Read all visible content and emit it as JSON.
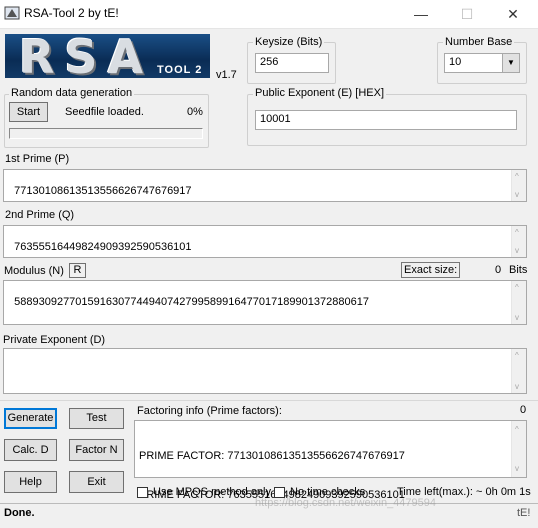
{
  "window": {
    "title": "RSA-Tool 2 by tE!",
    "minimize": "—",
    "maximize": "☐",
    "close": "✕"
  },
  "logo": {
    "text": "RSA",
    "subtitle": "TOOL 2",
    "version": "v1.7"
  },
  "keysize": {
    "label": "Keysize (Bits)",
    "value": "256"
  },
  "number_base": {
    "label": "Number Base",
    "value": "10"
  },
  "random": {
    "label": "Random data generation",
    "start_label": "Start",
    "status": "Seedfile loaded.",
    "percent": "0%",
    "progress": 0
  },
  "public_exponent": {
    "label": "Public Exponent (E) [HEX]",
    "value": "10001"
  },
  "prime1": {
    "label": "1st Prime (P)",
    "value": "77130108613513556626747676917"
  },
  "prime2": {
    "label": "2nd Prime (Q)",
    "value": "76355516449824909392590536101"
  },
  "modulus": {
    "label": "Modulus (N)",
    "r_label": "R",
    "exact_size_label": "Exact size:",
    "exact_size_value": "0",
    "bits_label": "Bits",
    "value": "5889309277015916307744940742799589916477017189901372880617"
  },
  "private_exponent": {
    "label": "Private Exponent (D)",
    "value": ""
  },
  "buttons": {
    "generate": "Generate",
    "test": "Test",
    "calc_d": "Calc. D",
    "factor_n": "Factor N",
    "help": "Help",
    "exit": "Exit"
  },
  "factoring": {
    "label": "Factoring info (Prime factors):",
    "count": "0",
    "lines": [
      "PRIME FACTOR: 77130108613513556626747676917",
      "PRIME FACTOR: 76355516449824909392590536101"
    ],
    "mpqs_label": "Use MPQS method only",
    "no_time_label": "No time checks",
    "time_left": "Time left(max.): ~ 0h 0m 1s"
  },
  "status": {
    "text": "Done.",
    "right": "tE!",
    "watermark": "https://blog.csdn.net/weixin_4479594"
  }
}
